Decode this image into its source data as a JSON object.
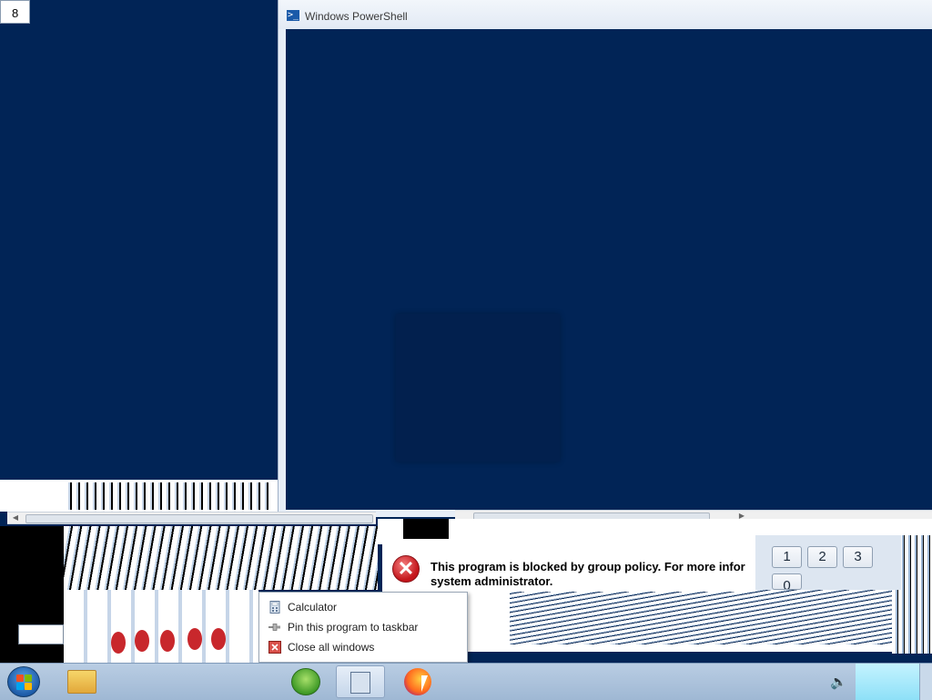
{
  "desktop": {
    "calc_display_value": "8"
  },
  "powershell": {
    "title": "Windows PowerShell"
  },
  "error_dialog": {
    "line1": "This program is blocked by group policy. For more infor",
    "line2": "system administrator."
  },
  "calculator_keys": [
    "1",
    "2",
    "3",
    "0"
  ],
  "jumplist": {
    "items": [
      {
        "label": "Calculator",
        "icon": "calculator-icon"
      },
      {
        "label": "Pin this program to taskbar",
        "icon": "pin-icon"
      },
      {
        "label": "Close all windows",
        "icon": "close-windows-icon"
      }
    ]
  },
  "taskbar": {
    "items": [
      "start-button",
      "windows-explorer",
      "media-center",
      "calculator",
      "firefox"
    ],
    "tray": [
      "volume-icon",
      "show-desktop"
    ]
  },
  "colors": {
    "console_bg": "#012456",
    "error_red": "#c4161c"
  }
}
